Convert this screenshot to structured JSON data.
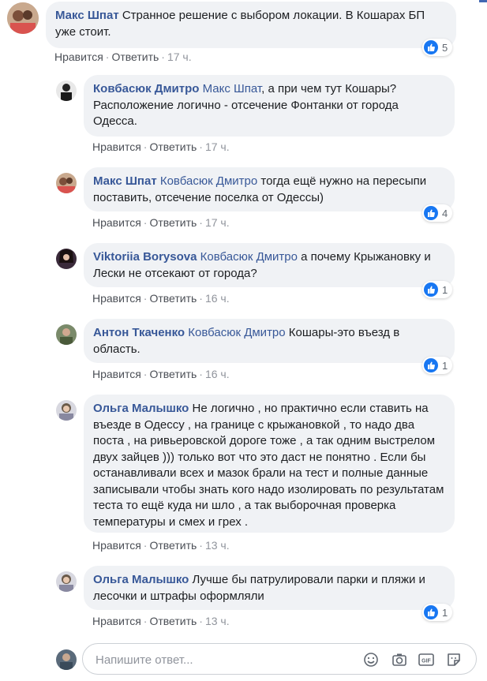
{
  "comments": [
    {
      "author": "Макс Шпат",
      "mention": "",
      "text": " Странное решение с выбором локации. В Кошарах БП уже стоит.",
      "like_label": "Нравится",
      "reply_label": "Ответить",
      "time": "17 ч.",
      "likes": "5"
    },
    {
      "author": "Ковбасюк Дмитро",
      "mention": "Макс Шпат",
      "text": ", а при чем тут Кошары? Расположение логично - отсечение Фонтанки от города Одесса.",
      "like_label": "Нравится",
      "reply_label": "Ответить",
      "time": "17 ч.",
      "likes": ""
    },
    {
      "author": "Макс Шпат",
      "mention": "Ковбасюк Дмитро",
      "text": " тогда ещё нужно на пересыпи поставить, отсечение поселка от Одессы)",
      "like_label": "Нравится",
      "reply_label": "Ответить",
      "time": "17 ч.",
      "likes": "4"
    },
    {
      "author": "Viktoriia Borysova",
      "mention": "Ковбасюк Дмитро",
      "text": " а почему Крыжановку и Лески не отсекают от города?",
      "like_label": "Нравится",
      "reply_label": "Ответить",
      "time": "16 ч.",
      "likes": "1"
    },
    {
      "author": "Антон Ткаченко",
      "mention": "Ковбасюк Дмитро",
      "text": " Кошары-это въезд в область.",
      "like_label": "Нравится",
      "reply_label": "Ответить",
      "time": "16 ч.",
      "likes": "1"
    },
    {
      "author": "Ольга Малышко",
      "mention": "",
      "text": " Не логично , но практично если ставить на въезде в Одессу , на границе с крыжановкой , то надо два поста , на ривьеровской дороге тоже , а так одним выстрелом двух зайцев ))) только вот что это даст не понятно . Если бы останавливали всех и мазок брали на тест и полные данные записывали чтобы знать кого надо изолировать по результатам теста то ещё куда ни шло , а так выборочная проверка температуры и смех и грех .",
      "like_label": "Нравится",
      "reply_label": "Ответить",
      "time": "13 ч.",
      "likes": ""
    },
    {
      "author": "Ольга Малышко",
      "mention": "",
      "text": " Лучше бы патрулировали парки и пляжи и лесочки и штрафы оформляли",
      "like_label": "Нравится",
      "reply_label": "Ответить",
      "time": "13 ч.",
      "likes": "1"
    }
  ],
  "reply_box": {
    "placeholder": "Напишите ответ..."
  },
  "icons": [
    "like-icon",
    "emoji-icon",
    "camera-icon",
    "gif-icon",
    "sticker-icon"
  ],
  "colors": {
    "link": "#385898",
    "bubble": "#f0f2f5",
    "like_blue": "#1877f2"
  }
}
